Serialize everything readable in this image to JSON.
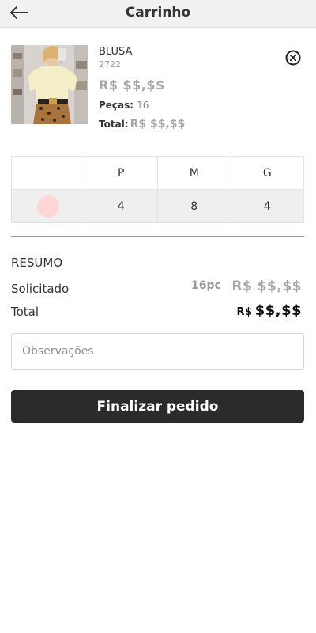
{
  "header": {
    "title": "Carrinho",
    "back_icon": "arrow-left-icon"
  },
  "item": {
    "name": "BLUSA",
    "code": "2722",
    "price": "R$ $$,$$",
    "qty_label": "Peças:",
    "qty_value": "16",
    "total_label": "Total:",
    "total_value": "R$ $$,$$",
    "remove_icon": "close-circle-icon"
  },
  "sizes": {
    "headers": [
      "",
      "P",
      "M",
      "G"
    ],
    "color_swatch": "#ffd6d6",
    "quantities": [
      "4",
      "8",
      "4"
    ]
  },
  "summary": {
    "title": "RESUMO",
    "requested_label": "Solicitado",
    "requested_qty": "16pc",
    "requested_value": "R$ $$,$$",
    "total_label": "Total",
    "total_currency": "R$",
    "total_amount": "$$,$$"
  },
  "notes": {
    "placeholder": "Observações"
  },
  "actions": {
    "finish_label": "Finalizar pedido"
  },
  "colors": {
    "primary_button": "#2b2b2b",
    "header_bg": "#f1f1f1",
    "muted_text": "#a8a8a8"
  }
}
